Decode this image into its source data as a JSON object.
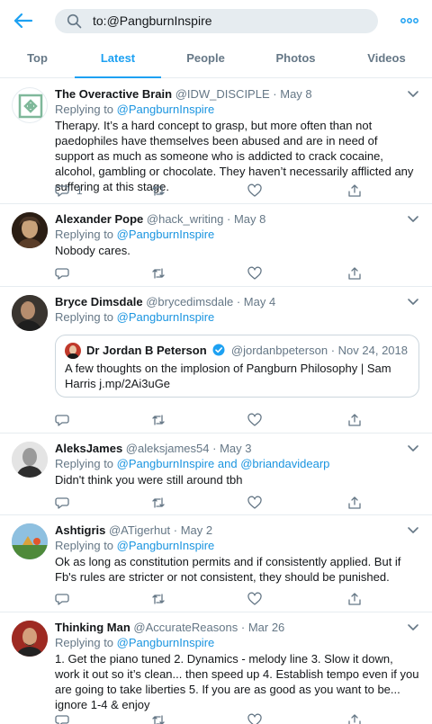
{
  "search": {
    "query": "to:@PangburnInspire"
  },
  "tabs": [
    {
      "label": "Top"
    },
    {
      "label": "Latest"
    },
    {
      "label": "People"
    },
    {
      "label": "Photos"
    },
    {
      "label": "Videos"
    }
  ],
  "tweets": [
    {
      "name": "The Overactive Brain",
      "handle": "@IDW_DISCIPLE",
      "dot": "·",
      "date": "May 8",
      "replying_prefix": "Replying to ",
      "replying_to": "@PangburnInspire",
      "body": "Therapy. It’s a hard concept to grasp, but more often than not paedophiles have themselves been abused and are in need of support as much as someone who is addicted to crack cocaine, alcohol, gambling or chocolate. They haven’t necessarily afflicted any suffering at this stage.",
      "reply_count": "1"
    },
    {
      "name": "Alexander Pope",
      "handle": "@hack_writing",
      "dot": "·",
      "date": "May 8",
      "replying_prefix": "Replying to ",
      "replying_to": "@PangburnInspire",
      "body": "Nobody cares."
    },
    {
      "name": "Bryce Dimsdale",
      "handle": "@brycedimsdale",
      "dot": "·",
      "date": "May 4",
      "replying_prefix": "Replying to ",
      "replying_to": "@PangburnInspire",
      "quote": {
        "name": "Dr Jordan B Peterson",
        "handle": "@jordanbpeterson",
        "dot": "·",
        "date": "Nov 24, 2018",
        "body": "A few thoughts on the implosion of Pangburn Philosophy | Sam Harris j.mp/2Ai3uGe"
      }
    },
    {
      "name": "AleksJames",
      "handle": "@aleksjames54",
      "dot": "·",
      "date": "May 3",
      "replying_prefix": "Replying to ",
      "replying_to": "@PangburnInspire",
      "replying_and": " and ",
      "replying_to_2": "@briandavidearp",
      "body": "Didn't think you were still around tbh"
    },
    {
      "name": "Ashtigris",
      "handle": "@ATigerhut",
      "dot": "·",
      "date": "May 2",
      "replying_prefix": "Replying to ",
      "replying_to": "@PangburnInspire",
      "body": "Ok as long as constitution permits and if consistently applied. But if Fb's rules are stricter or not consistent, they should be punished."
    },
    {
      "name": "Thinking Man",
      "handle": "@AccurateReasons",
      "dot": "·",
      "date": "Mar 26",
      "replying_prefix": "Replying to ",
      "replying_to": "@PangburnInspire",
      "body": "1. Get the piano tuned 2. Dynamics - melody line 3. Slow it down, work it out so it’s clean... then speed up 4. Establish tempo even if you are going to take liberties 5. If you are as good as you want to be... ignore 1-4 & enjoy"
    }
  ],
  "icons": {
    "back": "back-arrow-icon",
    "search": "search-icon",
    "more": "more-dots-icon",
    "caret": "chevron-down-icon",
    "reply": "reply-icon",
    "retweet": "retweet-icon",
    "like": "like-icon",
    "share": "share-icon",
    "verified": "verified-badge-icon"
  },
  "colors": {
    "accent": "#1da1f2",
    "link": "#1b95e0",
    "secondary_text": "#657786",
    "border": "#e6ecf0",
    "search_bg": "#e6ecf0"
  }
}
